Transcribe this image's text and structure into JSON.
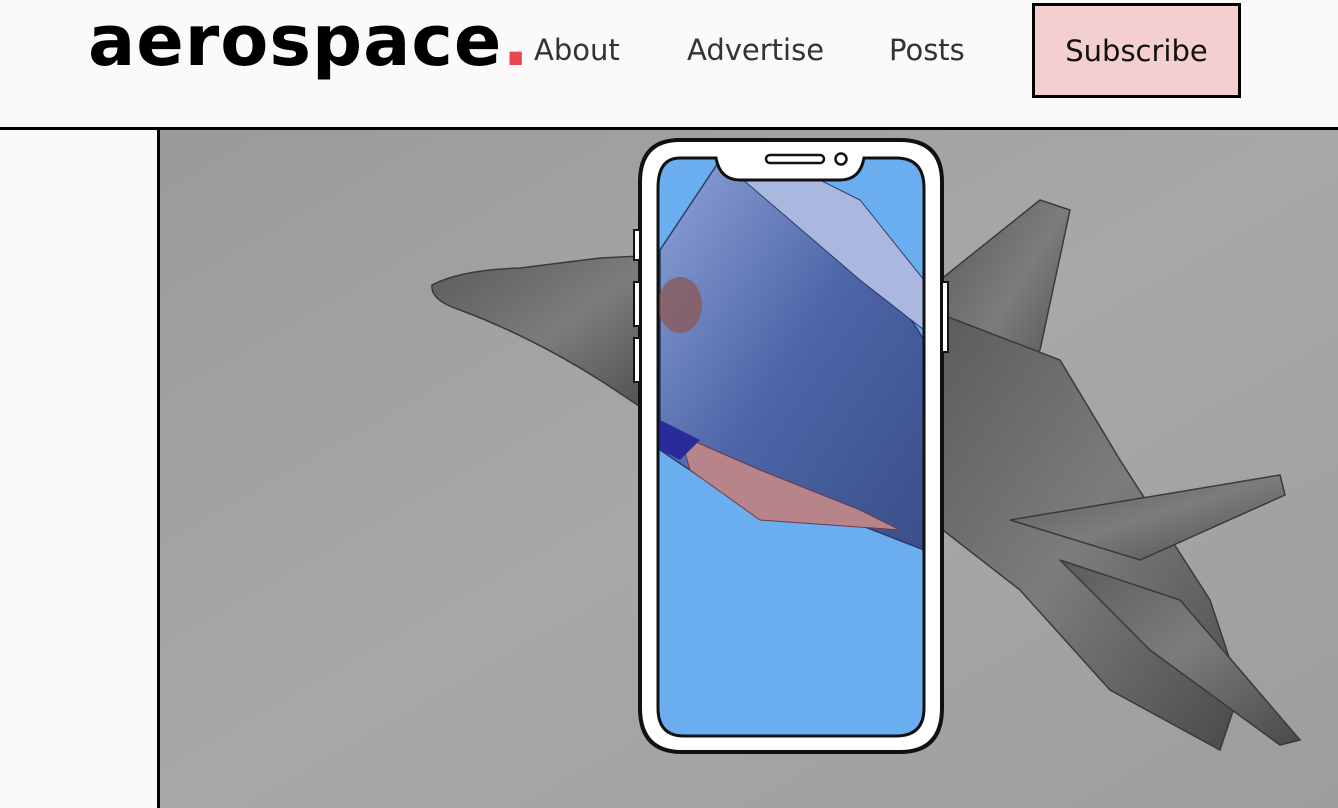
{
  "brand": {
    "name": "aerospace",
    "dot": ".",
    "dot_color": "#e8454f"
  },
  "nav": {
    "items": [
      {
        "label": "About"
      },
      {
        "label": "Advertise"
      },
      {
        "label": "Posts"
      }
    ],
    "subscribe_label": "Subscribe",
    "subscribe_bg": "#f4cfcf"
  },
  "hero": {
    "image": "fighter-jet-through-phone-illustration",
    "background": "#a3a3a3",
    "screen_color": "#6aaef0"
  }
}
